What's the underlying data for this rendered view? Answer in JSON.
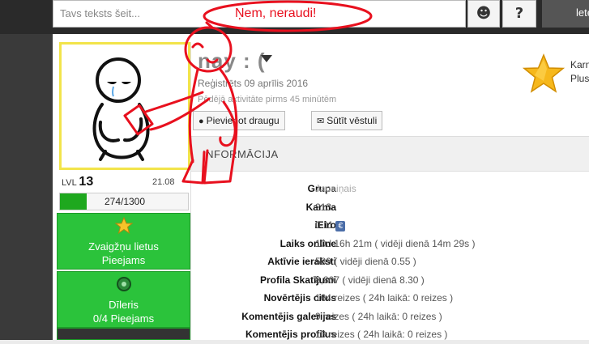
{
  "header": {
    "search_placeholder": "Tavs teksts šeit...",
    "smiley_icon": "☻",
    "help_label": "?",
    "right_stub": "lete"
  },
  "profile": {
    "username": "nay : (",
    "registered": "Reģistrēts 09 aprīlis 2016",
    "last_activity": "Pēdējā aktivitāte pirms 45 minūtēm",
    "add_friend_label": "Pievienot draugu",
    "send_message_label": "Sūtīt vēstuli",
    "karma_side": [
      "Karn",
      "Plus"
    ],
    "level_label": "LVL",
    "level": "13",
    "level_pct": "21.08",
    "xp_text": "274/1300",
    "xp_fraction": 0.21
  },
  "sidebar": {
    "items": [
      {
        "icon": "trophy-icon",
        "title": "Zvaigžņu lietus",
        "subtitle": "Pieejams"
      },
      {
        "icon": "dealer-icon",
        "title": "Dīleris",
        "subtitle": "0/4 Pieejams"
      }
    ]
  },
  "info": {
    "header": "INFORMĀCIJA",
    "rows": [
      {
        "label": "Grupa",
        "value": "Jauniņais",
        "muted": true
      },
      {
        "label": "Karma",
        "value": "213"
      },
      {
        "label": "iEiro",
        "value": "0.11",
        "badge": "€"
      },
      {
        "label": "Laiks online",
        "value": "10d 16h 21m ( vidēji dienā 14m 29s )"
      },
      {
        "label": "Aktīvie ieraksti",
        "value": "589 ( vidēji dienā 0.55 )"
      },
      {
        "label": "Profila Skatījumi",
        "value": "8,807 ( vidēji dienā 8.30 )"
      },
      {
        "label": "Novērtējis citus",
        "value": "164 reizes ( 24h laikā: 0 reizes )"
      },
      {
        "label": "Komentējis galerijas",
        "value": "9 reizes ( 24h laikā: 0 reizes )"
      },
      {
        "label": "Komentējis profilus",
        "value": "13 reizes ( 24h laikā: 0 reizes )"
      }
    ]
  },
  "doodle": {
    "speech": "Ņem, neraudi!",
    "color": "#e8101e"
  },
  "colors": {
    "accent_green": "#2bc33b",
    "avatar_frame": "#f2e44a",
    "star": "#f6b81c"
  }
}
